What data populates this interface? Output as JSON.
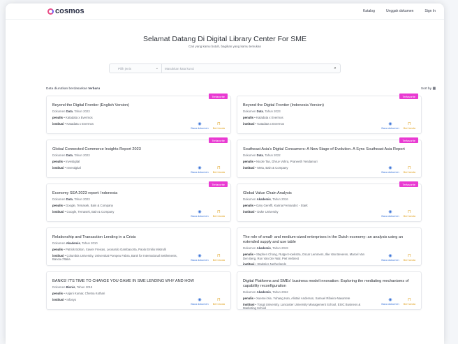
{
  "header": {
    "logo_text": "cosmos",
    "nav": [
      "Katalog",
      "Unggah dokumen",
      "Sign In"
    ]
  },
  "hero": {
    "title": "Selamat Datang Di Digital Library Center For SME",
    "subtitle": "Cari yang kamu butuh, bagikan yang kamu temukan"
  },
  "search": {
    "type_placeholder": "Pilih jenis",
    "keyword_placeholder": "Masukkan kata kunci"
  },
  "sort": {
    "label": "Data diurutkan berdasarkan",
    "value": "terbaru",
    "button": "Sort by"
  },
  "labels": {
    "penulis": "penulis",
    "institusi": "institusi",
    "read": "Baca dokumen",
    "save": "Beri tanda"
  },
  "colors": {
    "badge": "#e93ad2",
    "read": "#3b74d8",
    "save": "#e0a220"
  },
  "cards": [
    {
      "badge": "Terfavorite",
      "title": "Beyond the Digital Frontier (English Version)",
      "doc": "Dokumen",
      "type": "Data",
      "year": "Tahun 2023",
      "authors": "Katadata x Evermos",
      "institution": "Katadata x Evermos"
    },
    {
      "badge": "Terfavorite",
      "title": "Beyond the Digital Frontier (Indonesia Version)",
      "doc": "Dokumen",
      "type": "Data",
      "year": "Tahun 2023",
      "authors": "Katadata x Evermos",
      "institution": "Katadata x Evermos"
    },
    {
      "badge": "Terfavorite",
      "title": "Global Connected Commerce Insights Report 2023",
      "doc": "Dokumen",
      "type": "Data",
      "year": "Tahun 2023",
      "authors": "Investigital",
      "institution": "Investigital"
    },
    {
      "badge": "Terfavorite",
      "title": "Southeast Asia's Digital Consumers: A New Stage of Evolution. A Sync Southeast Asia Report",
      "doc": "Dokumen",
      "type": "Data",
      "year": "Tahun 2022",
      "authors": "Nicole Tan, Dhruv Vohra, Praneeth Yendamuri",
      "institution": "Meta, Bain & Company"
    },
    {
      "badge": "Terfavorite",
      "title": "Economy SEA 2023 report: Indonesia",
      "doc": "Dokumen",
      "type": "Data",
      "year": "Tahun 2023",
      "authors": "Google, Temasek, Bain & Company",
      "institution": "Google, Temasek, Bain & Company"
    },
    {
      "badge": "Terfavorite",
      "title": "Global Value Chain Analysis",
      "doc": "Dokumen",
      "type": "Akademis",
      "year": "Tahun 2016",
      "authors": "Gary Gereffi, Karina Fernandez - Stark",
      "institution": "Duke University"
    },
    {
      "badge": "",
      "title": "Relationship and Transaction Lending in a Crisis",
      "doc": "Dokumen",
      "type": "Akademis",
      "year": "Tahun 2010",
      "authors": "Patrick Bolton, Xavier Freixas, Leonardo Gambacorta, Paolo Emilio Mistrulli",
      "institution": "Columbia University, Universitat Pompeu Fabra, Bank for International Settlements, Banca d'Italia"
    },
    {
      "badge": "",
      "title": "The role of small- and medium-sized enterprises in the Dutch economy: an analysis using an extended supply and use table",
      "doc": "Dokumen",
      "type": "Akademis",
      "year": "Tahun 2019",
      "authors": "Stephen Chong, Rutger Hoekstra, Oscar Lemmers, Ilke Van Beveren, Marcel Van Den Berg, Ron Van Der Wal, Piet Verbiest",
      "institution": "Statistics Netherlands"
    },
    {
      "badge": "",
      "title": "BANKS! IT'S TIME TO CHANGE YOU GAME IN SME LENDING WHY AND HOW",
      "doc": "Dokumen",
      "type": "Bisnis",
      "year": "Tahun 2019",
      "authors": "Anjani Kumar, Chetna Kothari",
      "institution": "Infosys"
    },
    {
      "badge": "",
      "title": "Digital Platforms and SMEs' business model innovation: Exploring the mediating mechanisms of capability reconfiguration",
      "doc": "Dokumen",
      "type": "Akademis",
      "year": "Tahun 2022",
      "authors": "Xuemei Xie, Yuhang Han, Alistair Anderson, Samuel Ribeiro-Navarrete",
      "institution": "Tongji University, Lancaster University Management School, ESIC Business & Marketing School"
    }
  ]
}
